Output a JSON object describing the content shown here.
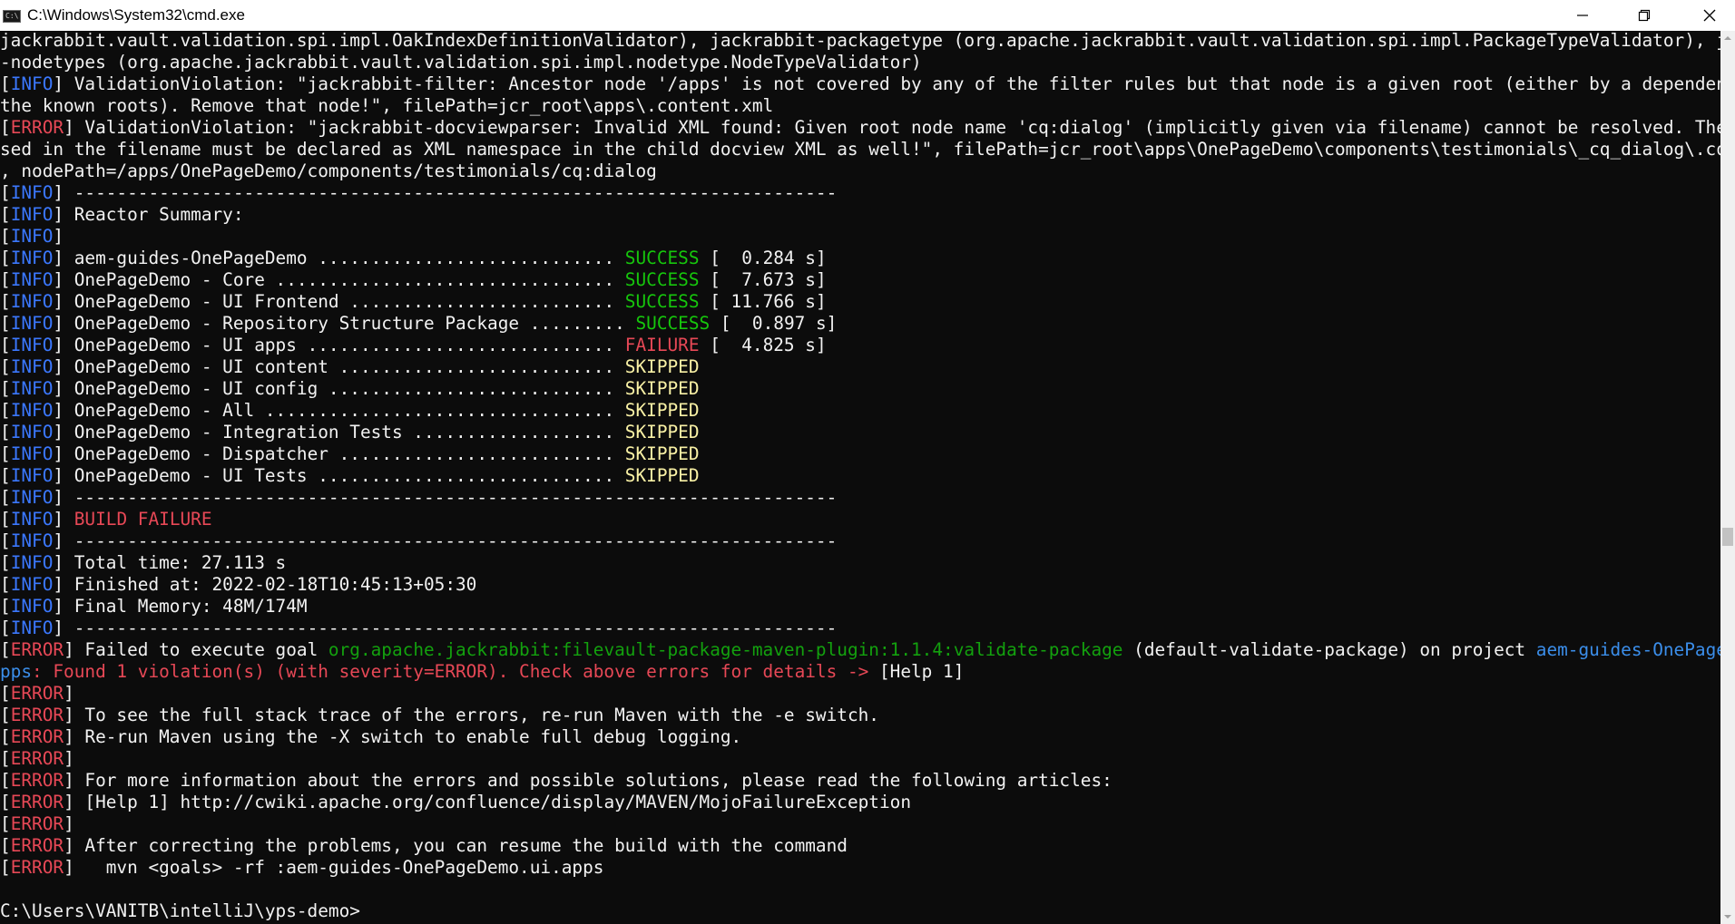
{
  "window": {
    "title": "C:\\Windows\\System32\\cmd.exe",
    "icon_text": "C:\\"
  },
  "colors": {
    "background": "#0c0c0c",
    "text": "#cccccc",
    "info": "#3b78ff",
    "error": "#e74856",
    "success": "#16c60c",
    "skipped": "#f9f1a5",
    "plugin": "#13a10e",
    "project": "#3b8eea"
  },
  "lines": [
    [
      {
        "t": "jackrabbit.vault.validation.spi.impl.OakIndexDefinitionValidator), jackrabbit-packagetype (org.apache.jackrabbit.vault.validation.spi.impl.PackageTypeValidator), jackrabbit",
        "c": "white"
      }
    ],
    [
      {
        "t": "-nodetypes (org.apache.jackrabbit.vault.validation.spi.impl.nodetype.NodeTypeValidator)",
        "c": "white"
      }
    ],
    [
      {
        "t": "[",
        "c": "white"
      },
      {
        "t": "INFO",
        "c": "info"
      },
      {
        "t": "] ValidationViolation: \"jackrabbit-filter: Ancestor node '/apps' is not covered by any of the filter rules but that node is a given root (either by a dependency or by",
        "c": "white"
      }
    ],
    [
      {
        "t": "the known roots). Remove that node!\", filePath=jcr_root\\apps\\.content.xml",
        "c": "white"
      }
    ],
    [
      {
        "t": "[",
        "c": "white"
      },
      {
        "t": "ERROR",
        "c": "error"
      },
      {
        "t": "] ValidationViolation: \"jackrabbit-docviewparser: Invalid XML found: Given root node name 'cq:dialog' (implicitly given via filename) cannot be resolved. The prefix u",
        "c": "white"
      }
    ],
    [
      {
        "t": "sed in the filename must be declared as XML namespace in the child docview XML as well!\", filePath=jcr_root\\apps\\OnePageDemo\\components\\testimonials\\_cq_dialog\\.content.xml",
        "c": "white"
      }
    ],
    [
      {
        "t": ", nodePath=/apps/OnePageDemo/components/testimonials/cq:dialog",
        "c": "white"
      }
    ],
    [
      {
        "t": "[",
        "c": "white"
      },
      {
        "t": "INFO",
        "c": "info"
      },
      {
        "t": "] ------------------------------------------------------------------------",
        "c": "white"
      }
    ],
    [
      {
        "t": "[",
        "c": "white"
      },
      {
        "t": "INFO",
        "c": "info"
      },
      {
        "t": "] Reactor Summary:",
        "c": "white"
      }
    ],
    [
      {
        "t": "[",
        "c": "white"
      },
      {
        "t": "INFO",
        "c": "info"
      },
      {
        "t": "]",
        "c": "white"
      }
    ],
    [
      {
        "t": "[",
        "c": "white"
      },
      {
        "t": "INFO",
        "c": "info"
      },
      {
        "t": "] aem-guides-OnePageDemo ............................ ",
        "c": "white"
      },
      {
        "t": "SUCCESS",
        "c": "success"
      },
      {
        "t": " [  0.284 s]",
        "c": "white"
      }
    ],
    [
      {
        "t": "[",
        "c": "white"
      },
      {
        "t": "INFO",
        "c": "info"
      },
      {
        "t": "] OnePageDemo - Core ................................ ",
        "c": "white"
      },
      {
        "t": "SUCCESS",
        "c": "success"
      },
      {
        "t": " [  7.673 s]",
        "c": "white"
      }
    ],
    [
      {
        "t": "[",
        "c": "white"
      },
      {
        "t": "INFO",
        "c": "info"
      },
      {
        "t": "] OnePageDemo - UI Frontend ......................... ",
        "c": "white"
      },
      {
        "t": "SUCCESS",
        "c": "success"
      },
      {
        "t": " [ 11.766 s]",
        "c": "white"
      }
    ],
    [
      {
        "t": "[",
        "c": "white"
      },
      {
        "t": "INFO",
        "c": "info"
      },
      {
        "t": "] OnePageDemo - Repository Structure Package ......... ",
        "c": "white"
      },
      {
        "t": "SUCCESS",
        "c": "success"
      },
      {
        "t": " [  0.897 s]",
        "c": "white"
      }
    ],
    [
      {
        "t": "[",
        "c": "white"
      },
      {
        "t": "INFO",
        "c": "info"
      },
      {
        "t": "] OnePageDemo - UI apps ............................. ",
        "c": "white"
      },
      {
        "t": "FAILURE",
        "c": "error"
      },
      {
        "t": " [  4.825 s]",
        "c": "white"
      }
    ],
    [
      {
        "t": "[",
        "c": "white"
      },
      {
        "t": "INFO",
        "c": "info"
      },
      {
        "t": "] OnePageDemo - UI content .......................... ",
        "c": "white"
      },
      {
        "t": "SKIPPED",
        "c": "yellow"
      }
    ],
    [
      {
        "t": "[",
        "c": "white"
      },
      {
        "t": "INFO",
        "c": "info"
      },
      {
        "t": "] OnePageDemo - UI config ........................... ",
        "c": "white"
      },
      {
        "t": "SKIPPED",
        "c": "yellow"
      }
    ],
    [
      {
        "t": "[",
        "c": "white"
      },
      {
        "t": "INFO",
        "c": "info"
      },
      {
        "t": "] OnePageDemo - All ................................. ",
        "c": "white"
      },
      {
        "t": "SKIPPED",
        "c": "yellow"
      }
    ],
    [
      {
        "t": "[",
        "c": "white"
      },
      {
        "t": "INFO",
        "c": "info"
      },
      {
        "t": "] OnePageDemo - Integration Tests ................... ",
        "c": "white"
      },
      {
        "t": "SKIPPED",
        "c": "yellow"
      }
    ],
    [
      {
        "t": "[",
        "c": "white"
      },
      {
        "t": "INFO",
        "c": "info"
      },
      {
        "t": "] OnePageDemo - Dispatcher .......................... ",
        "c": "white"
      },
      {
        "t": "SKIPPED",
        "c": "yellow"
      }
    ],
    [
      {
        "t": "[",
        "c": "white"
      },
      {
        "t": "INFO",
        "c": "info"
      },
      {
        "t": "] OnePageDemo - UI Tests ............................ ",
        "c": "white"
      },
      {
        "t": "SKIPPED",
        "c": "yellow"
      }
    ],
    [
      {
        "t": "[",
        "c": "white"
      },
      {
        "t": "INFO",
        "c": "info"
      },
      {
        "t": "] ------------------------------------------------------------------------",
        "c": "white"
      }
    ],
    [
      {
        "t": "[",
        "c": "white"
      },
      {
        "t": "INFO",
        "c": "info"
      },
      {
        "t": "] ",
        "c": "white"
      },
      {
        "t": "BUILD FAILURE",
        "c": "error"
      }
    ],
    [
      {
        "t": "[",
        "c": "white"
      },
      {
        "t": "INFO",
        "c": "info"
      },
      {
        "t": "] ------------------------------------------------------------------------",
        "c": "white"
      }
    ],
    [
      {
        "t": "[",
        "c": "white"
      },
      {
        "t": "INFO",
        "c": "info"
      },
      {
        "t": "] Total time: 27.113 s",
        "c": "white"
      }
    ],
    [
      {
        "t": "[",
        "c": "white"
      },
      {
        "t": "INFO",
        "c": "info"
      },
      {
        "t": "] Finished at: 2022-02-18T10:45:13+05:30",
        "c": "white"
      }
    ],
    [
      {
        "t": "[",
        "c": "white"
      },
      {
        "t": "INFO",
        "c": "info"
      },
      {
        "t": "] Final Memory: 48M/174M",
        "c": "white"
      }
    ],
    [
      {
        "t": "[",
        "c": "white"
      },
      {
        "t": "INFO",
        "c": "info"
      },
      {
        "t": "] ------------------------------------------------------------------------",
        "c": "white"
      }
    ],
    [
      {
        "t": "[",
        "c": "white"
      },
      {
        "t": "ERROR",
        "c": "error"
      },
      {
        "t": "] Failed to execute goal ",
        "c": "white"
      },
      {
        "t": "org.apache.jackrabbit:filevault-package-maven-plugin:1.1.4:validate-package",
        "c": "green"
      },
      {
        "t": " (default-validate-package) on project ",
        "c": "white"
      },
      {
        "t": "aem-guides-OnePageDemo.ui.a",
        "c": "blue"
      }
    ],
    [
      {
        "t": "pps",
        "c": "blue"
      },
      {
        "t": ": Found 1 violation(s) (with severity=ERROR). Check above errors for details -> ",
        "c": "error"
      },
      {
        "t": "[Help 1]",
        "c": "white"
      }
    ],
    [
      {
        "t": "[",
        "c": "white"
      },
      {
        "t": "ERROR",
        "c": "error"
      },
      {
        "t": "]",
        "c": "white"
      }
    ],
    [
      {
        "t": "[",
        "c": "white"
      },
      {
        "t": "ERROR",
        "c": "error"
      },
      {
        "t": "] To see the full stack trace of the errors, re-run Maven with the -e switch.",
        "c": "white"
      }
    ],
    [
      {
        "t": "[",
        "c": "white"
      },
      {
        "t": "ERROR",
        "c": "error"
      },
      {
        "t": "] Re-run Maven using the -X switch to enable full debug logging.",
        "c": "white"
      }
    ],
    [
      {
        "t": "[",
        "c": "white"
      },
      {
        "t": "ERROR",
        "c": "error"
      },
      {
        "t": "]",
        "c": "white"
      }
    ],
    [
      {
        "t": "[",
        "c": "white"
      },
      {
        "t": "ERROR",
        "c": "error"
      },
      {
        "t": "] For more information about the errors and possible solutions, please read the following articles:",
        "c": "white"
      }
    ],
    [
      {
        "t": "[",
        "c": "white"
      },
      {
        "t": "ERROR",
        "c": "error"
      },
      {
        "t": "] [Help 1] http://cwiki.apache.org/confluence/display/MAVEN/MojoFailureException",
        "c": "white"
      }
    ],
    [
      {
        "t": "[",
        "c": "white"
      },
      {
        "t": "ERROR",
        "c": "error"
      },
      {
        "t": "]",
        "c": "white"
      }
    ],
    [
      {
        "t": "[",
        "c": "white"
      },
      {
        "t": "ERROR",
        "c": "error"
      },
      {
        "t": "] After correcting the problems, you can resume the build with the command",
        "c": "white"
      }
    ],
    [
      {
        "t": "[",
        "c": "white"
      },
      {
        "t": "ERROR",
        "c": "error"
      },
      {
        "t": "]   mvn <goals> -rf :aem-guides-OnePageDemo.ui.apps",
        "c": "white"
      }
    ],
    [
      {
        "t": "",
        "c": "white"
      }
    ],
    [
      {
        "t": "C:\\Users\\VANITB\\intelliJ\\yps-demo>",
        "c": "white"
      }
    ]
  ]
}
